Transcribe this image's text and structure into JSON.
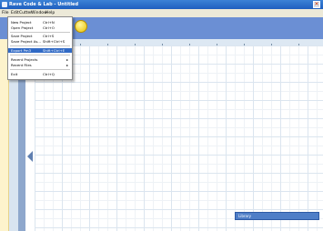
{
  "window": {
    "title": "Rave Code & Lab - Untitled",
    "close_glyph": "✕"
  },
  "menubar": {
    "items": [
      "File",
      "Edit",
      "Cutter",
      "Window",
      "Help"
    ]
  },
  "file_menu": {
    "items": [
      {
        "label": "New Project",
        "shortcut": "Ctrl+N"
      },
      {
        "label": "Open Project",
        "shortcut": "Ctrl+O"
      },
      {
        "label": "Save Project",
        "shortcut": "Ctrl+S"
      },
      {
        "label": "Save Project As...",
        "shortcut": "Shift+Ctrl+S"
      },
      {
        "label": "Export Pm3",
        "shortcut": "Shift+Ctrl+E",
        "highlighted": true
      },
      {
        "label": "Recent Projects",
        "submenu_arrow": "▸"
      },
      {
        "label": "Recent Files",
        "submenu_arrow": "▸"
      },
      {
        "label": "Exit",
        "shortcut": "Ctrl+Q"
      }
    ]
  },
  "status_panel": {
    "label": "Library"
  },
  "icons": [
    "app-icon",
    "smiley-icon",
    "collapse-arrow-icon",
    "close-icon"
  ]
}
